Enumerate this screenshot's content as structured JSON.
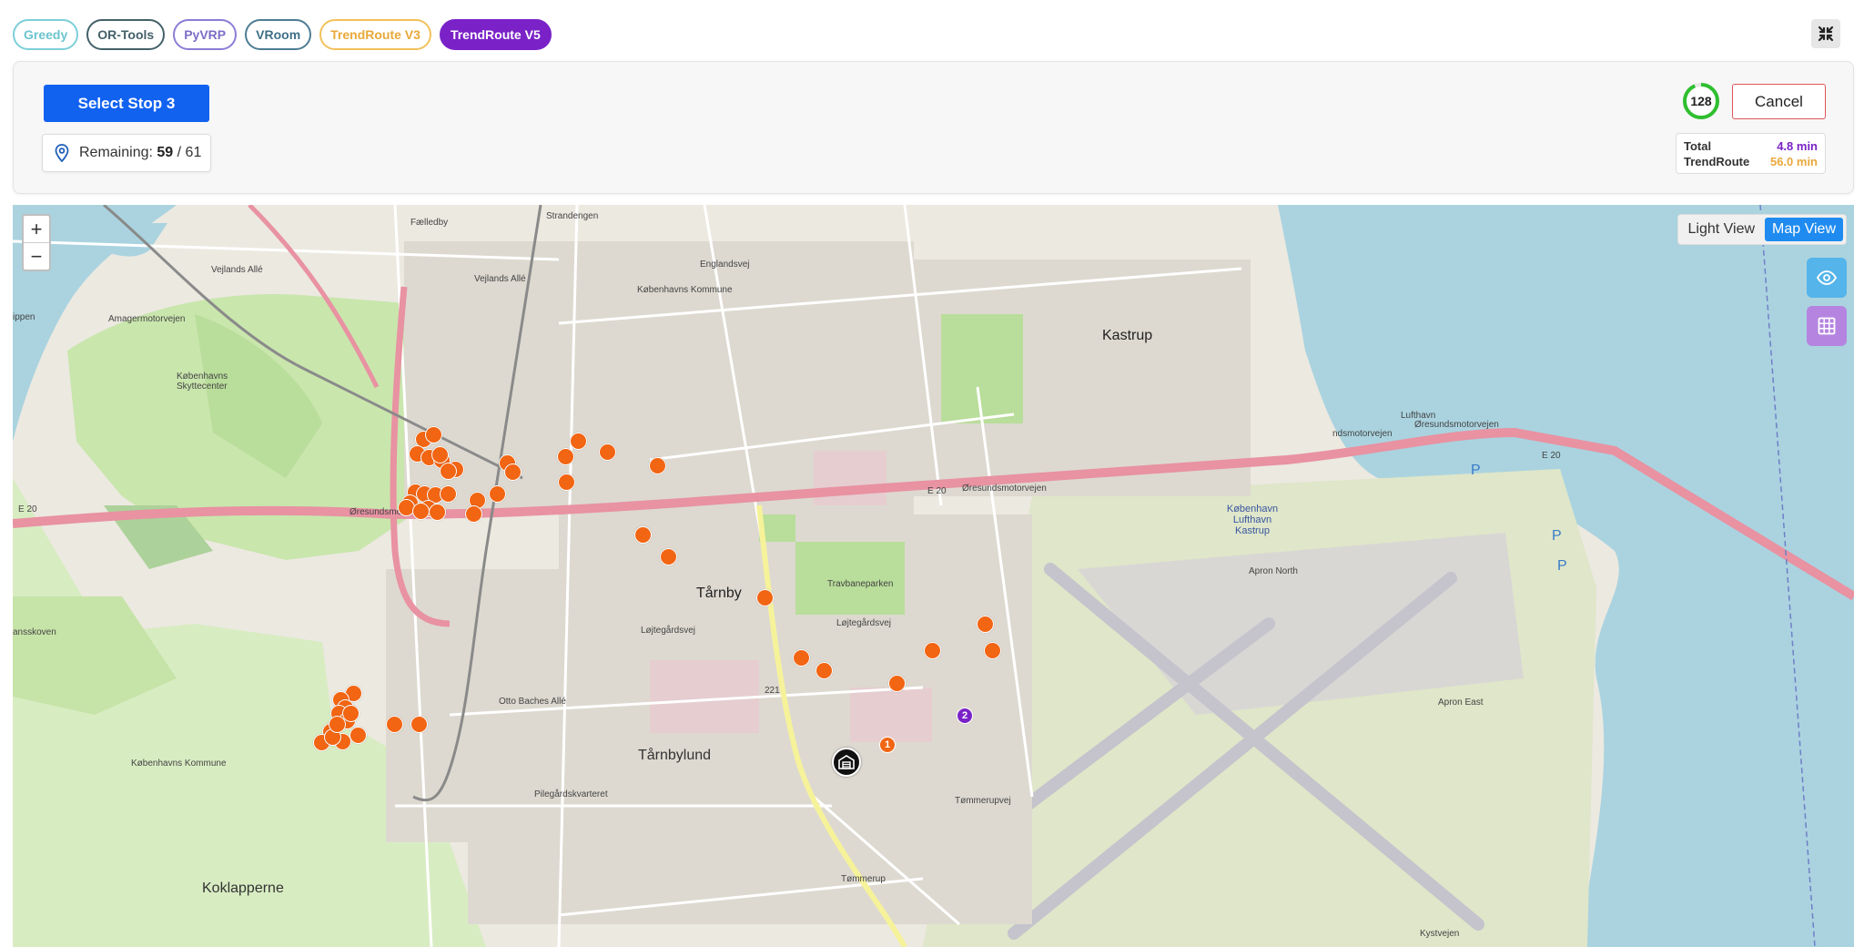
{
  "algorithms": [
    "Greedy",
    "OR-Tools",
    "PyVRP",
    "VRoom",
    "TrendRoute V3",
    "TrendRoute V5"
  ],
  "active_algorithm": "TrendRoute V5",
  "panel": {
    "select_label": "Select Stop 3",
    "remaining_label": "Remaining:",
    "remaining_count": "59",
    "remaining_sep": "/",
    "remaining_total": "61",
    "ring_value": "128",
    "ring_color": "#2fbf2f",
    "cancel_label": "Cancel",
    "total_label": "Total",
    "total_value": "4.8 min",
    "trendroute_label": "TrendRoute",
    "trendroute_value": "56.0 min"
  },
  "map": {
    "zoom_in": "+",
    "zoom_out": "−",
    "views": [
      "Light View",
      "Map View"
    ],
    "active_view": "Map View",
    "labels": {
      "kastrup": "Kastrup",
      "tarnby": "Tårnby",
      "tarnbylund": "Tårnbylund",
      "koklapperne": "Koklapperne",
      "tommerup": "Tømmerup",
      "skovsho": "ansskoven",
      "apron_north": "Apron North",
      "apron_east": "Apron East",
      "airport": "København Lufthavn Kastrup",
      "e20_left": "E 20",
      "e20_mid": "E 20",
      "e20_right": "E 20",
      "oresund1": "Øresundsmotorvejen",
      "oresund2": "Øresundsmotorvejen",
      "oresund3": "Øresundsmotorvejen",
      "vejlands1": "Vejlands Allé",
      "vejlands2": "Vejlands Allé",
      "kbh_kommune1": "Københavns Kommune",
      "kbh_kommune2": "Københavns Kommune",
      "skyttecenter": "Københavns Skyttecenter",
      "travbane": "Travbaneparken",
      "lojtegard1": "Løjtegårdsvej",
      "lojtegard2": "Løjtegårdsvej",
      "pilegard": "Pilegårdskvarteret",
      "amager": "Amagermotorvejen",
      "lufthavn": "Lufthavn",
      "ndsmotorvejen": "ndsmotorvejen",
      "fasan": "Fælledby",
      "strandengen": "Strandengen",
      "r221": "221",
      "parking": "P",
      "otto": "Otto Baches Allé",
      "engvej": "Englandsvej",
      "tommerupvej": "Tømmerupvej",
      "kystvejen": "Kystvejen",
      "jappen": "ippen"
    },
    "stop_badges": [
      "1",
      "2"
    ],
    "depot_icon": "warehouse-icon"
  }
}
